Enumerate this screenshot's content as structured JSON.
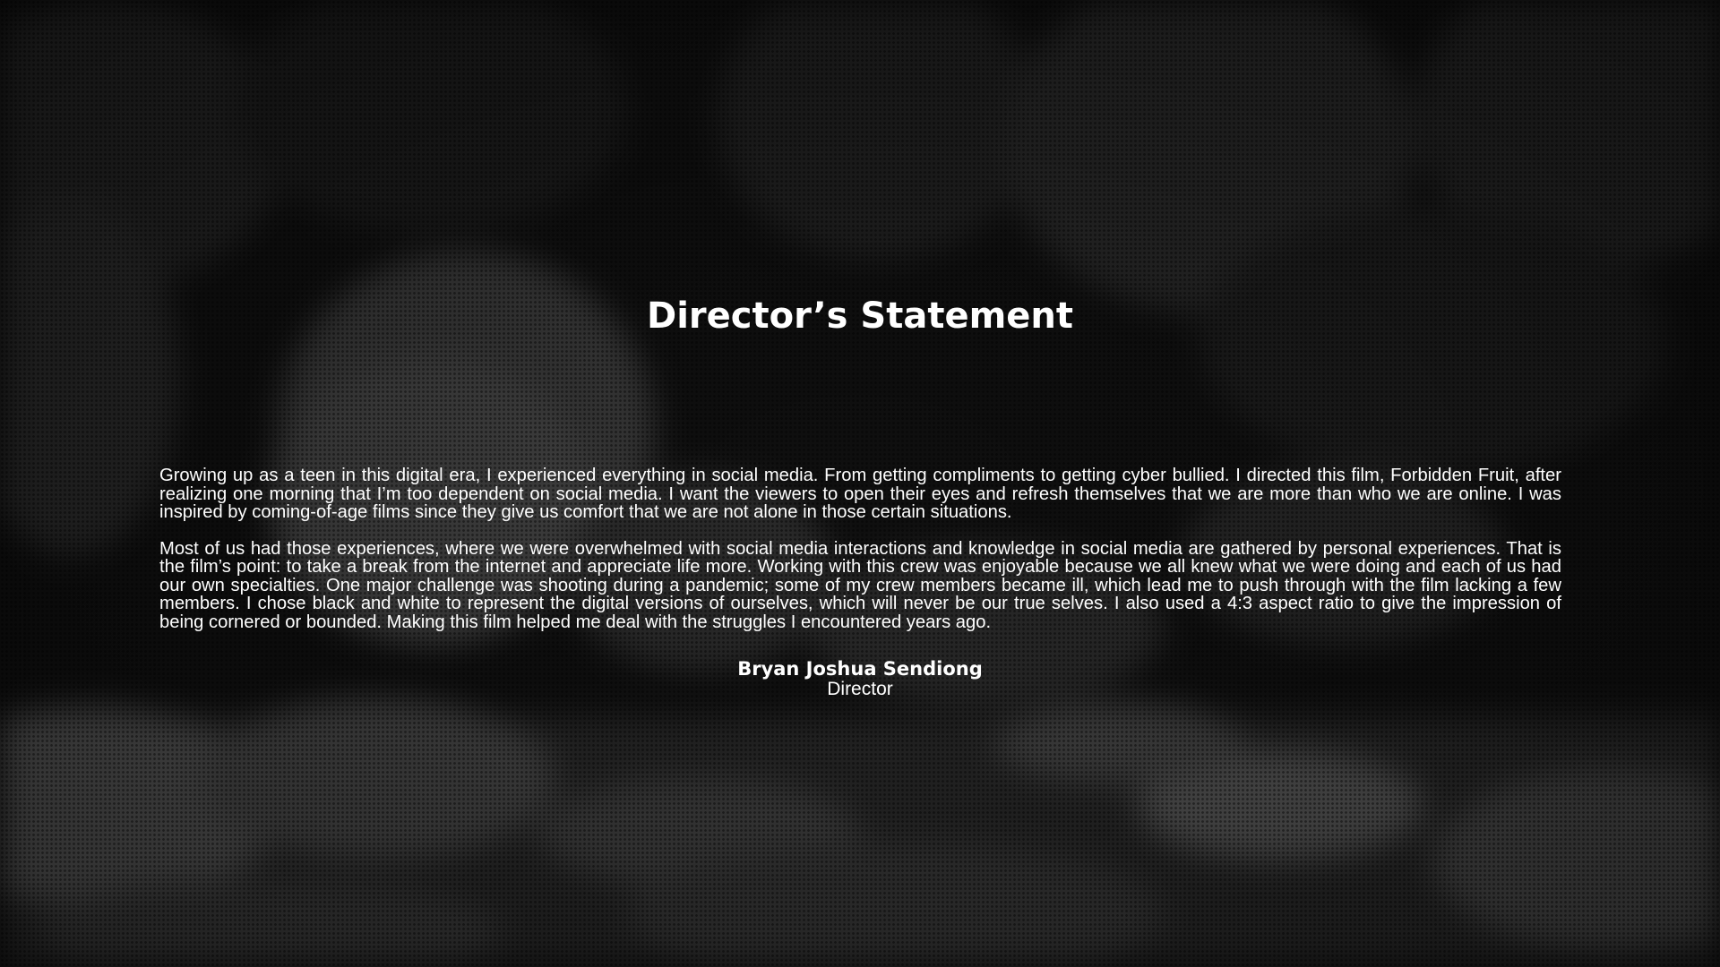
{
  "title": "Director’s Statement",
  "paragraphs": [
    "Growing up as a teen in this digital era, I experienced everything in social media. From getting compliments to getting cyber bullied. I directed this film, Forbidden Fruit, after realizing one morning that I’m too dependent on social media. I want the viewers to open their eyes and refresh themselves that we are more than who we are online. I was inspired by coming-of-age films since they give us comfort that we are not alone in those certain situations.",
    "Most of us had those experiences, where we were overwhelmed with social media interactions and knowledge in social media are gathered by personal experiences. That is the film’s point: to take a break from the internet and appreciate life more. Working with this crew was enjoyable because we all knew what we were doing and each of us had our own specialties. One major challenge was shooting during a pandemic; some of my crew members became ill, which lead me to push through with the film lacking a few members. I chose black and white to represent the digital versions of ourselves, which will never be our true selves. I also used a 4:3 aspect ratio to give the impression of being cornered or bounded. Making this film helped me deal with the struggles I encountered years ago."
  ],
  "signature": {
    "name": "Bryan Joshua Sendiong",
    "role": "Director"
  }
}
